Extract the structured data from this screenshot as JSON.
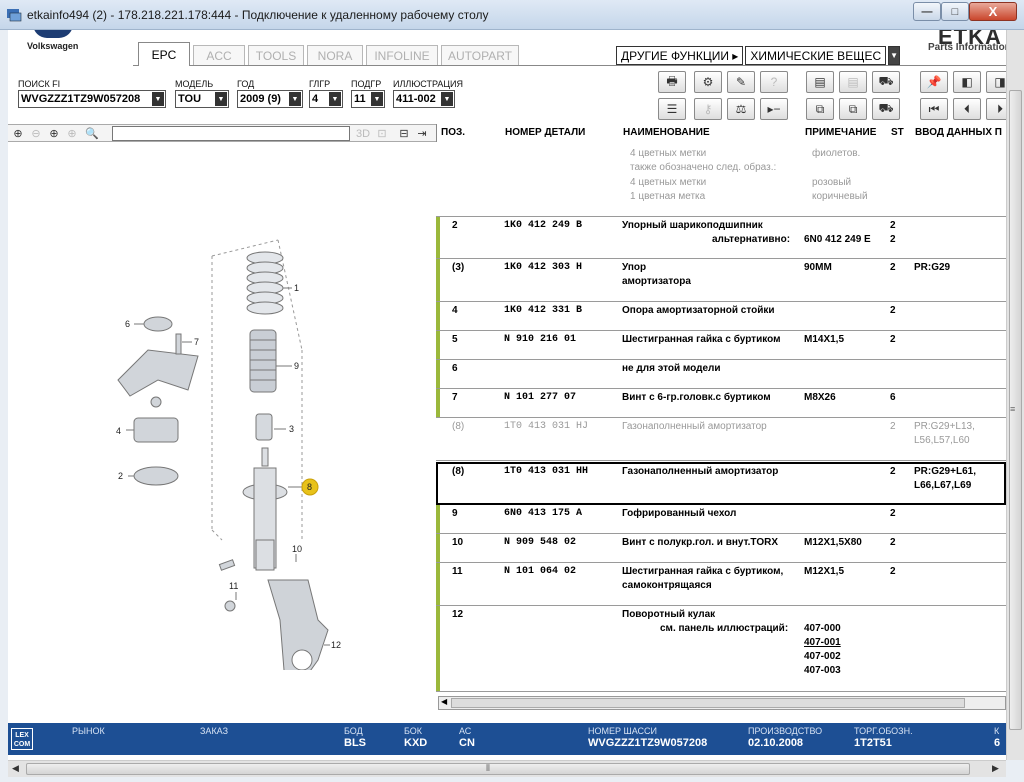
{
  "window": {
    "title": "etkainfo494 (2) - 178.218.221.178:444 - Подключение к удаленному рабочему столу",
    "close_label": "X",
    "maximize_label": "□",
    "minimize_label": "—"
  },
  "header": {
    "brand": "Volkswagen",
    "logo_text": "ETKA",
    "parts_info": "Parts Information",
    "tabs": [
      {
        "label": "EPC",
        "active": true
      },
      {
        "label": "ACC"
      },
      {
        "label": "TOOLS"
      },
      {
        "label": "NORA"
      },
      {
        "label": "INFOLINE"
      },
      {
        "label": "AUTOPART"
      }
    ],
    "other_functions": "ДРУГИЕ ФУНКЦИИ ▸",
    "chem_select": "ХИМИЧЕСКИЕ ВЕЩЕС"
  },
  "filters": {
    "search_fi": {
      "label": "ПОИСК FI",
      "value": "WVGZZZ1TZ9W057208"
    },
    "model": {
      "label": "МОДЕЛЬ",
      "value": "TOU"
    },
    "year": {
      "label": "ГОД",
      "value": "2009 (9)"
    },
    "group": {
      "label": "ГЛГР",
      "value": "4"
    },
    "subgroup": {
      "label": "ПОДГР",
      "value": "11"
    },
    "illustration": {
      "label": "ИЛЛЮСТРАЦИЯ",
      "value": "411-002"
    }
  },
  "columns": {
    "pos": "ПОЗ.",
    "part": "НОМЕР ДЕТАЛИ",
    "name": "НАИМЕНОВАНИЕ",
    "note": "ПРИМЕЧАНИЕ",
    "st": "ST",
    "input": "ВВОД ДАННЫХ П"
  },
  "top_notes": [
    {
      "name": "4 цветных метки",
      "note": "фиолетов."
    },
    {
      "name": "также обозначено след. образ.:",
      "note": ""
    },
    {
      "name": "4 цветных метки",
      "note": "розовый"
    },
    {
      "name": "1 цветная метка",
      "note": "коричневый"
    }
  ],
  "rows": [
    {
      "pos": "2",
      "part": "1K0  412  249  B",
      "name": "Упорный шарикоподшипник",
      "name2": "альтернативно:",
      "note": "6N0 412 249 E",
      "st": "2",
      "st2": "2",
      "data": ""
    },
    {
      "pos": "(3)",
      "part": "1K0  412  303  H",
      "name": "Упор",
      "name2": "амортизатора",
      "note": "90MM",
      "st": "2",
      "data": "PR:G29"
    },
    {
      "pos": "4",
      "part": "1K0  412  331  B",
      "name": "Опора амортизаторной стойки",
      "note": "",
      "st": "2",
      "data": ""
    },
    {
      "pos": "5",
      "part": "N    910  216  01",
      "name": "Шестигранная гайка с буртиком",
      "note": "M14X1,5",
      "st": "2",
      "data": ""
    },
    {
      "pos": "6",
      "part": "",
      "name": "не для этой модели",
      "note": "",
      "st": "",
      "data": ""
    },
    {
      "pos": "7",
      "part": "N    101  277  07",
      "name": "Винт с 6-гр.головк.с буртиком",
      "note": "M8X26",
      "st": "6",
      "data": ""
    },
    {
      "pos": "(8)",
      "part": "1T0  413  031  HJ",
      "name": "Газонаполненный амортизатор",
      "note": "",
      "st": "2",
      "data": "PR:G29+L13,",
      "data2": "L56,L57,L60"
    },
    {
      "pos": "(8)",
      "part": "1T0  413  031  HH",
      "name": "Газонаполненный амортизатор",
      "note": "",
      "st": "2",
      "data": "PR:G29+L61,",
      "data2": "L66,L67,L69"
    },
    {
      "pos": "9",
      "part": "6N0  413  175  A",
      "name": "Гофрированный чехол",
      "note": "",
      "st": "2",
      "data": ""
    },
    {
      "pos": "10",
      "part": "N    909  548  02",
      "name": "Винт с полукр.гол. и внут.TORX",
      "note": "M12X1,5X80",
      "st": "2",
      "data": ""
    },
    {
      "pos": "11",
      "part": "N    101  064  02",
      "name": "Шестигранная гайка с буртиком,",
      "name2": "самоконтрящаяся",
      "note": "M12X1,5",
      "st": "2",
      "data": ""
    },
    {
      "pos": "12",
      "part": "",
      "name": "Поворотный кулак",
      "name2": "см. панель иллюстраций:",
      "note": "407-000",
      "links": [
        "407-001",
        "407-002",
        "407-003"
      ],
      "st": "",
      "data": ""
    }
  ],
  "diagram": {
    "callouts": [
      "1",
      "2",
      "3",
      "4",
      "6",
      "7",
      "8",
      "9",
      "10",
      "11",
      "12"
    ],
    "highlight": "8"
  },
  "toolbar2": {
    "field_3d": "3D"
  },
  "status": {
    "logo": "LEX COM",
    "market": {
      "label": "РЫНОК",
      "value": ""
    },
    "order": {
      "label": "ЗАКАЗ",
      "value": ""
    },
    "bod": {
      "label": "БОД",
      "value": "BLS"
    },
    "bok": {
      "label": "БОК",
      "value": "KXD"
    },
    "ac": {
      "label": "АС",
      "value": "CN"
    },
    "vin": {
      "label": "НОМЕР ШАССИ",
      "value": "WVGZZZ1TZ9W057208"
    },
    "prod": {
      "label": "ПРОИЗВОДСТВО",
      "value": "02.10.2008"
    },
    "trade": {
      "label": "ТОРГ.ОБОЗН.",
      "value": "1T2T51"
    },
    "extra": {
      "label": "К",
      "value": "6"
    }
  },
  "colors": {
    "accent_bar": "#9bb83b",
    "status_bg": "#1d4f94",
    "highlight_callout": "#e8c21a"
  }
}
